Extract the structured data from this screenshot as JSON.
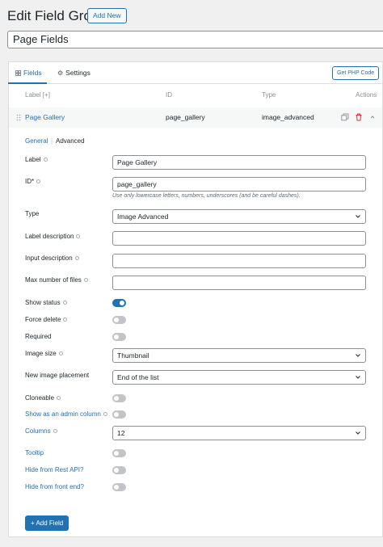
{
  "header": {
    "title": "Edit Field Group",
    "add_new_label": "Add New"
  },
  "title_input": {
    "value": "Page Fields"
  },
  "tabs": [
    {
      "label": "Fields",
      "icon": "fields-grid-icon",
      "active": true
    },
    {
      "label": "Settings",
      "icon": "gear-icon",
      "active": false
    }
  ],
  "php_button_label": "Get PHP Code",
  "columns": {
    "label": "Label [+]",
    "id": "ID",
    "type": "Type",
    "actions": "Actions"
  },
  "field_row": {
    "label": "Page Gallery",
    "id": "page_gallery",
    "type": "image_advanced"
  },
  "subtabs": {
    "general": "General",
    "separator": "|",
    "advanced": "Advanced"
  },
  "form": {
    "label": {
      "label": "Label",
      "value": "Page Gallery"
    },
    "id": {
      "label": "ID*",
      "value": "page_gallery",
      "hint": "Use only lowercase letters, numbers, underscores (and be careful dashes)."
    },
    "type": {
      "label": "Type",
      "value": "Image Advanced"
    },
    "label_description": {
      "label": "Label description",
      "value": ""
    },
    "input_description": {
      "label": "Input description",
      "value": ""
    },
    "max_files": {
      "label": "Max number of files",
      "value": ""
    },
    "show_status": {
      "label": "Show status",
      "on": true
    },
    "force_delete": {
      "label": "Force delete",
      "on": false
    },
    "required": {
      "label": "Required",
      "on": false
    },
    "image_size": {
      "label": "Image size",
      "value": "Thumbnail"
    },
    "new_image_placement": {
      "label": "New image placement",
      "value": "End of the list"
    },
    "cloneable": {
      "label": "Cloneable",
      "on": false
    },
    "admin_column": {
      "label": "Show as an admin column",
      "on": false
    },
    "columns": {
      "label": "Columns",
      "value": "12"
    },
    "tooltip": {
      "label": "Tooltip",
      "on": false
    },
    "hide_rest": {
      "label": "Hide from Rest API?",
      "on": false
    },
    "hide_front": {
      "label": "Hide from front end?",
      "on": false
    }
  },
  "add_field_label": "+ Add Field",
  "colors": {
    "accent": "#2271b1",
    "danger": "#d63638",
    "toggle_off": "#c3c4c7"
  }
}
